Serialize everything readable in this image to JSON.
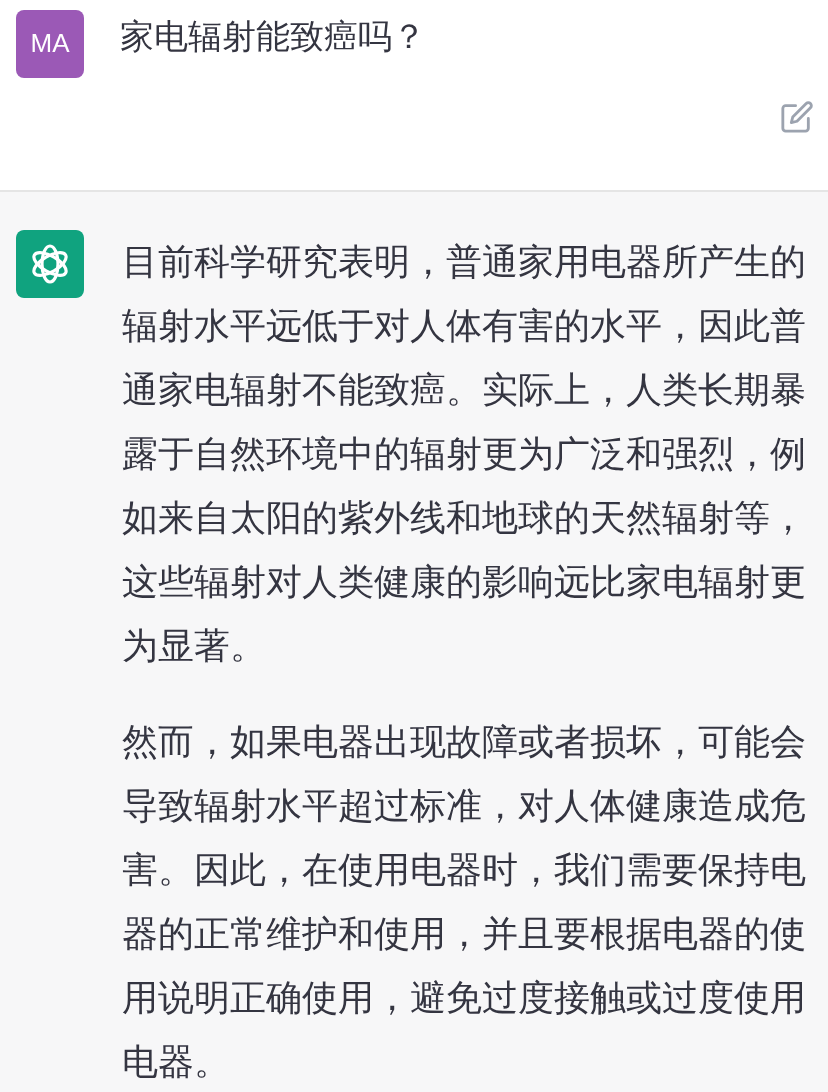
{
  "question": {
    "avatar": "MA",
    "text": "家电辐射能致癌吗？"
  },
  "answer": {
    "paragraphs": [
      "目前科学研究表明，普通家用电器所产生的辐射水平远低于对人体有害的水平，因此普通家电辐射不能致癌。实际上，人类长期暴露于自然环境中的辐射更为广泛和强烈，例如来自太阳的紫外线和地球的天然辐射等，这些辐射对人类健康的影响远比家电辐射更为显著。",
      "然而，如果电器出现故障或者损坏，可能会导致辐射水平超过标准，对人体健康造成危害。因此，在使用电器时，我们需要保持电器的正常维护和使用，并且要根据电器的使用说明正确使用，避免过度接触或过度使用电器。"
    ]
  }
}
